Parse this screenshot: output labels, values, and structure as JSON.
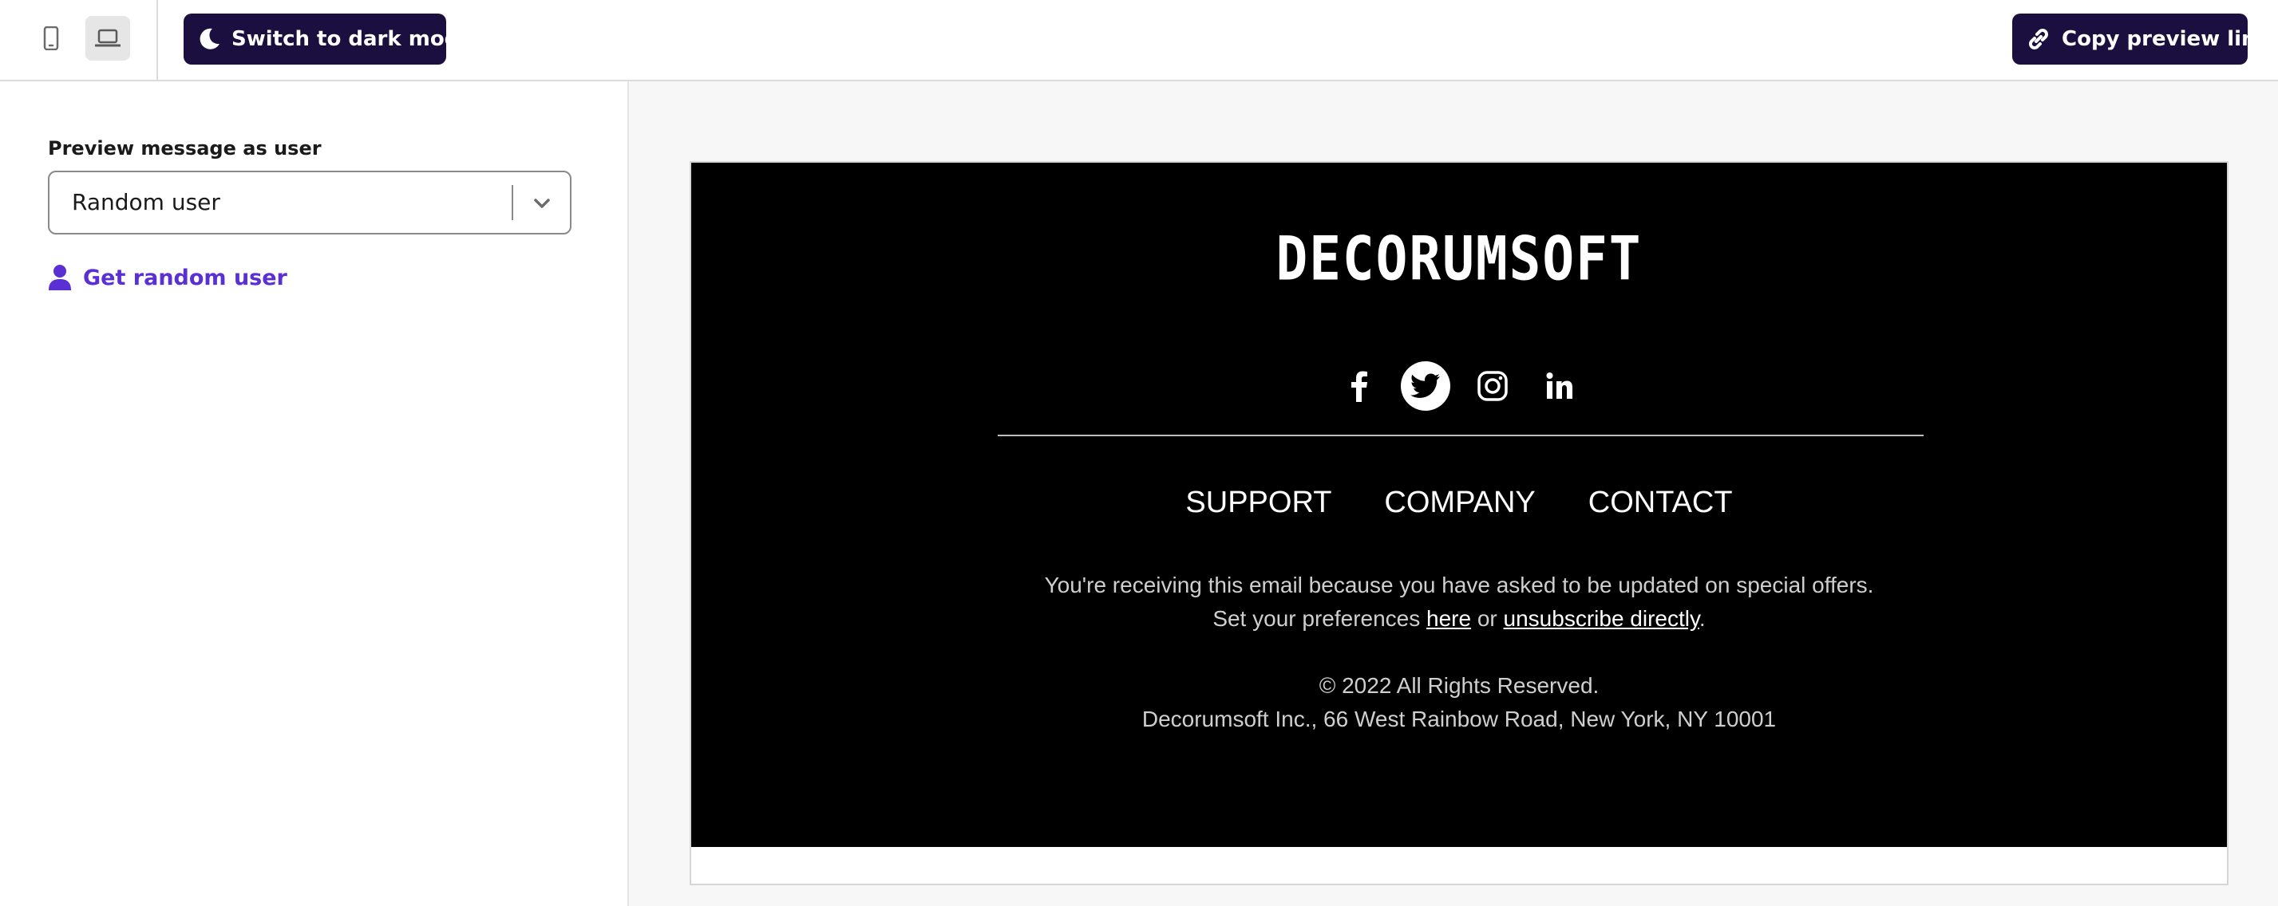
{
  "toolbar": {
    "mobile_view": "mobile-view",
    "desktop_view": "desktop-view",
    "dark_mode_label": "Switch to dark mode",
    "copy_link_label": "Copy preview link"
  },
  "sidebar": {
    "field_label": "Preview message as user",
    "select_value": "Random user",
    "random_user_label": "Get random user"
  },
  "email": {
    "logo": "DECORUMSOFT",
    "social_icons": [
      "facebook-icon",
      "twitter-icon",
      "instagram-icon",
      "linkedin-icon"
    ],
    "nav": [
      "SUPPORT",
      "COMPANY",
      "CONTACT"
    ],
    "notice": "You're receiving this email because you have asked to be updated on special offers.",
    "prefs_prefix": "Set your preferences ",
    "prefs_here": "here",
    "prefs_or": " or ",
    "prefs_unsub": "unsubscribe directly",
    "prefs_suffix": ".",
    "copyright": "© 2022 All Rights Reserved.",
    "address": "Decorumsoft Inc., 66 West Rainbow Road, New York, NY 10001"
  },
  "colors": {
    "button_bg": "#1b0f3f",
    "accent_link": "#5a2fd3",
    "email_bg": "#000000"
  }
}
